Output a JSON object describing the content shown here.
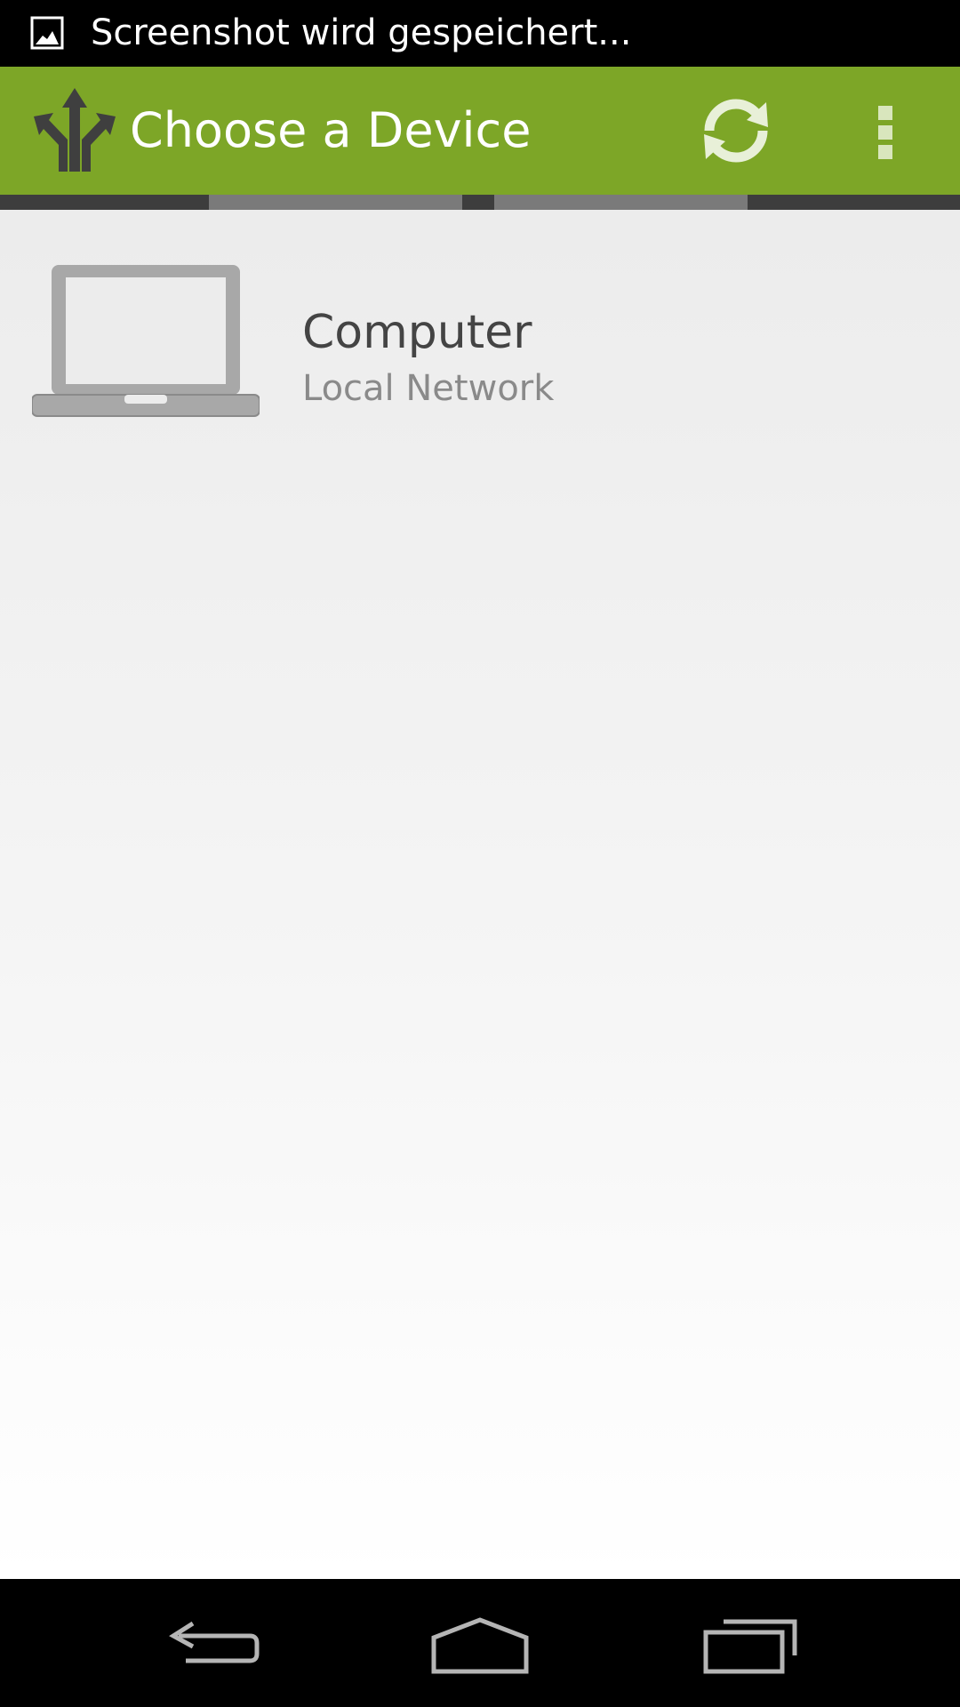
{
  "status_bar": {
    "notification_text": "Screenshot wird gespeichert...",
    "notification_icon": "image-icon"
  },
  "action_bar": {
    "title": "Choose a Device",
    "app_icon": "split-arrows-icon",
    "refresh_icon": "refresh-icon",
    "overflow_icon": "overflow-menu-icon",
    "background_color": "#7da627"
  },
  "devices": [
    {
      "name": "Computer",
      "subtitle": "Local Network",
      "icon": "laptop-icon"
    }
  ],
  "nav_bar": {
    "back_icon": "back-icon",
    "home_icon": "home-icon",
    "recent_icon": "recent-apps-icon"
  }
}
